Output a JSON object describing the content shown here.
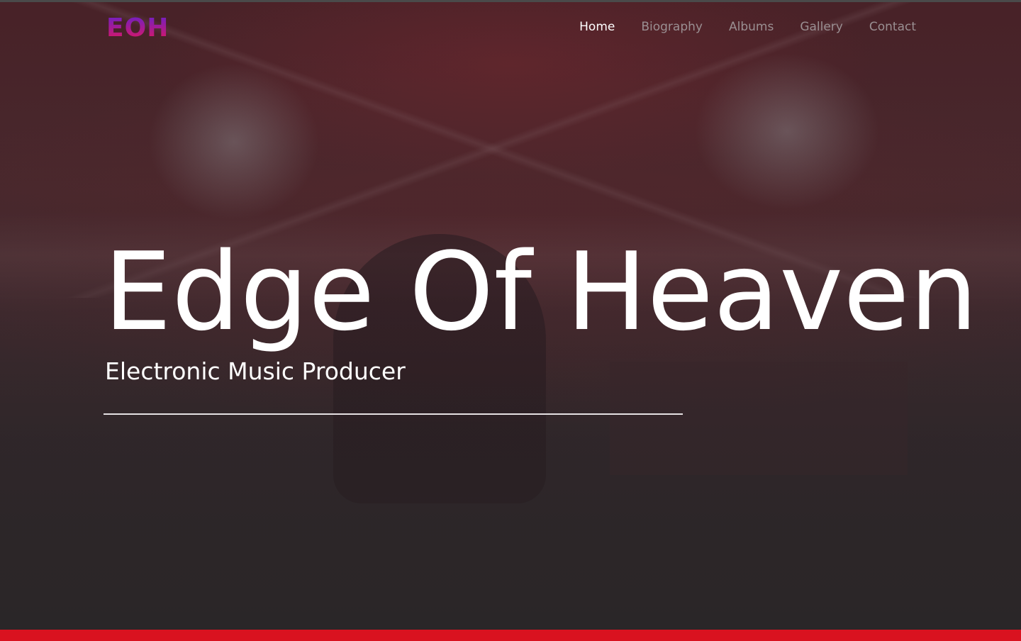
{
  "header": {
    "logo_text": "EOH",
    "nav": [
      {
        "label": "Home",
        "active": true
      },
      {
        "label": "Biography",
        "active": false
      },
      {
        "label": "Albums",
        "active": false
      },
      {
        "label": "Gallery",
        "active": false
      },
      {
        "label": "Contact",
        "active": false
      }
    ]
  },
  "hero": {
    "title": "Edge Of Heaven",
    "subtitle": "Electronic Music Producer"
  },
  "colors": {
    "logo_gradient_top": "#6a1fc9",
    "logo_gradient_bottom": "#e3175b",
    "accent_bar": "#d9121f",
    "nav_active": "#ffffff",
    "nav_inactive": "#9a8f92"
  }
}
